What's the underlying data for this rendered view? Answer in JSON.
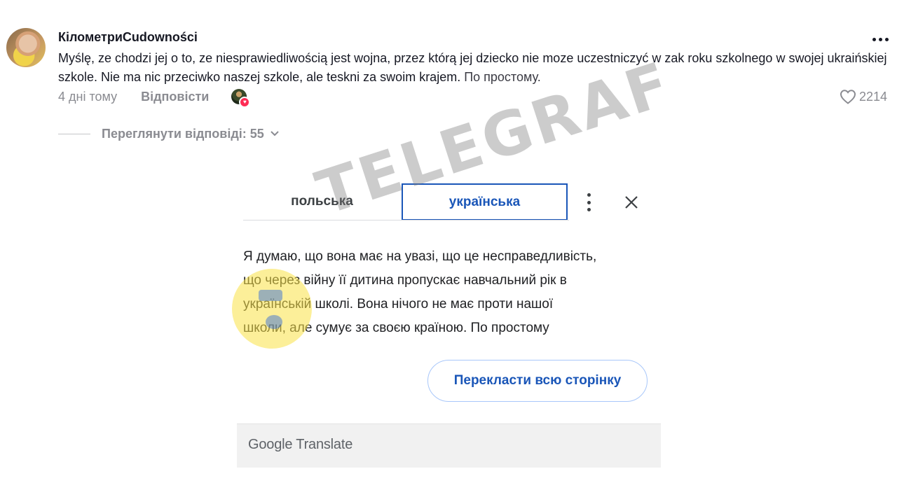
{
  "comment": {
    "username": "КілометриCudowności",
    "text_original": "Myślę, ze chodzi jej o to, ze niesprawiedliwością jest wojna, przez którą jej dziecko nie moze uczestniczyć w zak roku szkolnego w swojej ukraińskiej szkole. Nie ma nic przeciwko naszej szkole, ale teskni za swoim krajem.",
    "text_tail": " По простому.",
    "date": "4 дні тому",
    "reply_label": "Відповісти",
    "likes": "2214",
    "view_replies_label": "Переглянути відповіді: 55"
  },
  "translate_popup": {
    "tab_source": "польська",
    "tab_target": "українська",
    "translation_lines": [
      "Я думаю, що вона має на увазі, що це несправедливість,",
      "що через війну її дитина пропускає навчальний рік в",
      "українській школі. Вона нічого не має проти нашої",
      "школи, але сумує за своєю країною. По простому"
    ],
    "translate_page_button": "Перекласти всю сторінку",
    "footer_brand": "Google",
    "footer_product": "Translate"
  },
  "watermark": {
    "text": "TELEGRAF"
  },
  "colors": {
    "accent_blue": "#1a56b8",
    "like_pink": "#fe2c55",
    "muted_text": "#8a8b91"
  }
}
